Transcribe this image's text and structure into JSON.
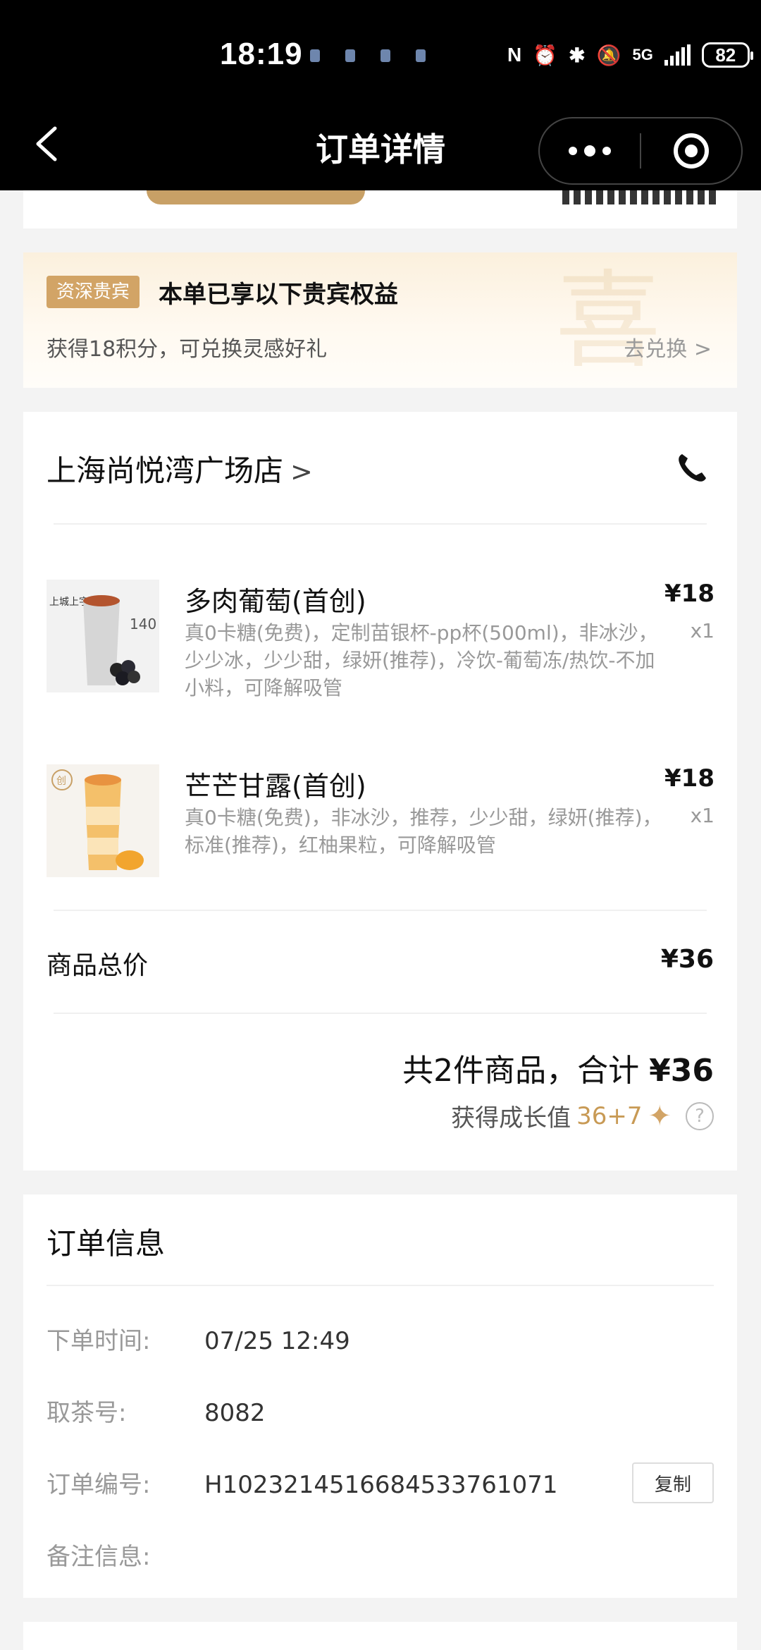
{
  "status_bar": {
    "time": "18:19",
    "network": "5G",
    "battery": "82"
  },
  "nav": {
    "title": "订单详情",
    "back_icon": "chevron-left-icon",
    "more_icon": "more-dots-icon",
    "close_icon": "target-circle-icon"
  },
  "vip": {
    "badge": "资深贵宾",
    "headline": "本单已享以下贵宾权益",
    "points_text": "获得18积分，可兑换灵感好礼",
    "redeem_label": "去兑换 >",
    "watermark": "喜"
  },
  "order": {
    "store_name": "上海尚悦湾广场店",
    "items": [
      {
        "name": "多肉葡萄(首创)",
        "desc": "真0卡糖(免费)，定制苗银杯-pp杯(500ml)，非冰沙，少少冰，少少甜，绿妍(推荐)，冷饮-葡萄冻/热饮-不加小料，可降解吸管",
        "price": "¥18",
        "qty": "x1",
        "thumb_text": "上城上字 140"
      },
      {
        "name": "芒芒甘露(首创)",
        "desc": "真0卡糖(免费)，非冰沙，推荐，少少甜，绿妍(推荐)，标准(推荐)，红柚果粒，可降解吸管",
        "price": "¥18",
        "qty": "x1",
        "thumb_text": "创"
      }
    ],
    "subtotal_label": "商品总价",
    "subtotal_value": "¥36",
    "total_prefix": "共2件商品，合计",
    "total_value": "¥36",
    "growth_label": "获得成长值",
    "growth_value": "36+7"
  },
  "info": {
    "title": "订单信息",
    "order_time_label": "下单时间:",
    "order_time_value": "07/25 12:49",
    "pickup_label": "取茶号:",
    "pickup_value": "8082",
    "order_no_label": "订单编号:",
    "order_no_value": "H1023214516684533761071",
    "copy_label": "复制",
    "remark_label": "备注信息:"
  }
}
